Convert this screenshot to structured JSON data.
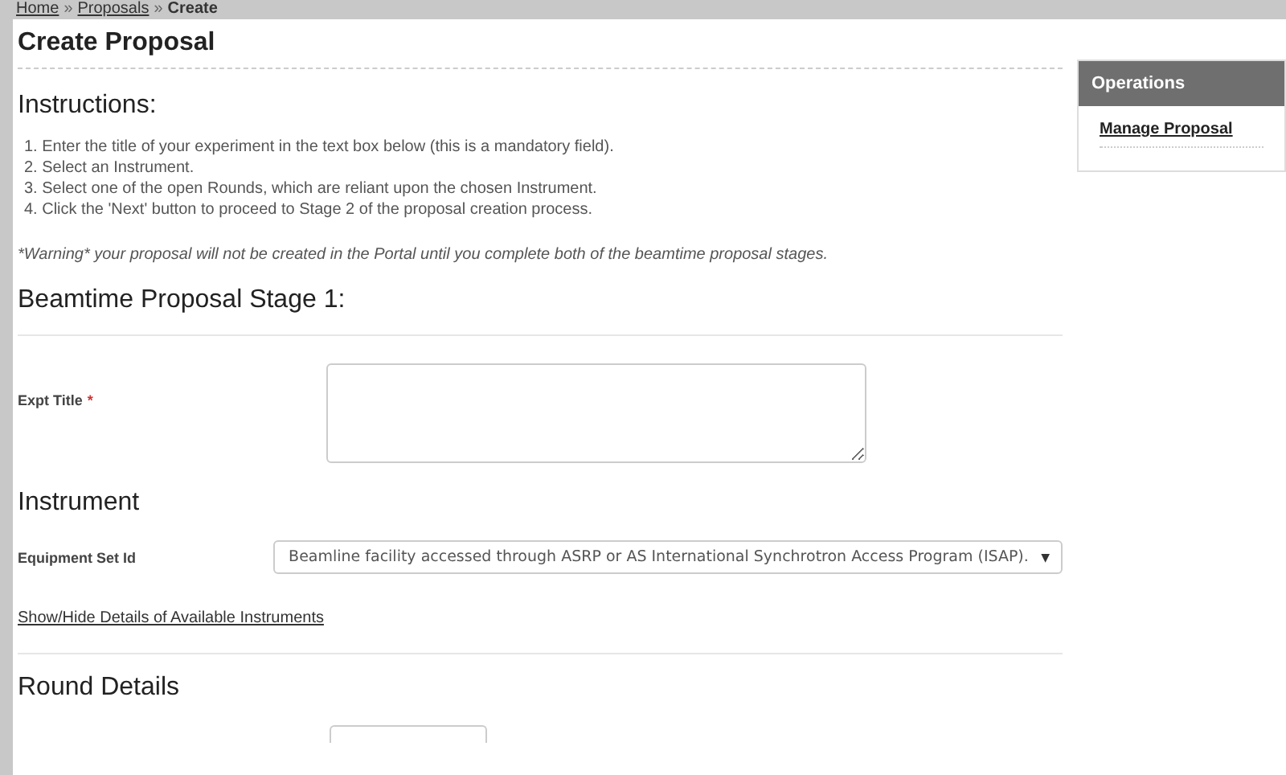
{
  "breadcrumb": [
    {
      "label": "Home",
      "link": true
    },
    {
      "label": "Proposals",
      "link": true
    },
    {
      "label": "Create",
      "link": false
    }
  ],
  "breadcrumb_separator": "»",
  "page_title": "Create Proposal",
  "instructions": {
    "heading": "Instructions:",
    "steps": [
      "1. Enter the title of your experiment in the text box below (this is a mandatory field).",
      "2. Select an Instrument.",
      "3. Select one of the open Rounds, which are reliant upon the chosen Instrument.",
      "4. Click the 'Next' button to proceed to Stage 2 of the proposal creation process."
    ],
    "warning": "*Warning* your proposal will not be created in the Portal until you complete both of the beamtime proposal stages."
  },
  "stage_heading": "Beamtime Proposal Stage 1:",
  "expt_title": {
    "label": "Expt Title",
    "required_mark": "*"
  },
  "instrument": {
    "heading": "Instrument",
    "label": "Equipment Set Id",
    "value": "Beamline facility accessed through ASRP or AS International Synchrotron Access Program (ISAP).",
    "caret": "▼",
    "toggle_link": "Show/Hide Details of Available Instruments"
  },
  "round_heading": "Round Details",
  "sidebar": {
    "title": "Operations",
    "items": [
      "Manage Proposal"
    ]
  }
}
